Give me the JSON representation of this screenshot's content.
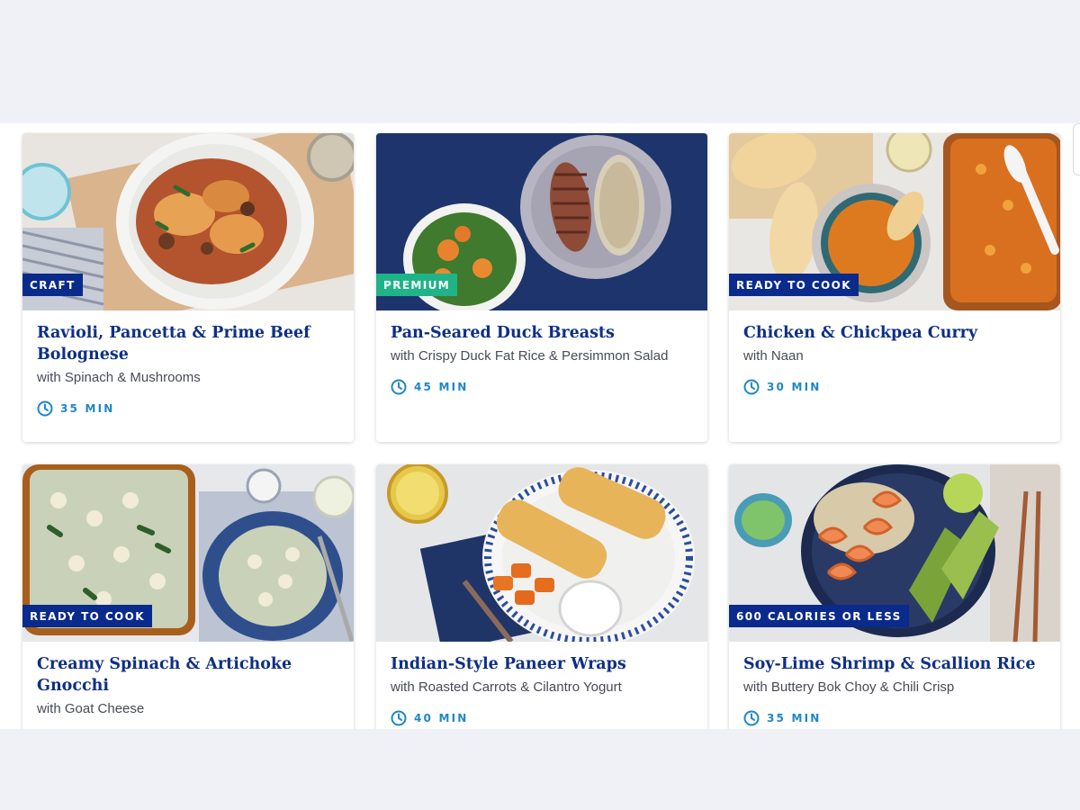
{
  "colors": {
    "title": "#0e2f86",
    "badge_navy": "#0a2a8c",
    "badge_green": "#1fb487",
    "time": "#1f87c6",
    "page_bg": "#f0f1f6"
  },
  "icons": {
    "time": "clock-icon"
  },
  "recipes": [
    {
      "title": "Ravioli, Pancetta & Prime Beef Bolognese",
      "subtitle": "with Spinach & Mushrooms",
      "badge": "CRAFT",
      "time": "35 MIN"
    },
    {
      "title": "Pan-Seared Duck Breasts",
      "subtitle": "with Crispy Duck Fat Rice & Persimmon Salad",
      "badge": "PREMIUM",
      "time": "45 MIN"
    },
    {
      "title": "Chicken & Chickpea Curry",
      "subtitle": "with Naan",
      "badge": "READY TO COOK",
      "time": "30 MIN"
    },
    {
      "title": "Creamy Spinach & Artichoke Gnocchi",
      "subtitle": "with Goat Cheese",
      "badge": "READY TO COOK",
      "time": ""
    },
    {
      "title": "Indian-Style Paneer Wraps",
      "subtitle": "with Roasted Carrots & Cilantro Yogurt",
      "badge": "",
      "time": "40 MIN"
    },
    {
      "title": "Soy-Lime Shrimp & Scallion Rice",
      "subtitle": "with Buttery Bok Choy & Chili Crisp",
      "badge": "600 CALORIES OR LESS",
      "time": "35 MIN"
    }
  ]
}
